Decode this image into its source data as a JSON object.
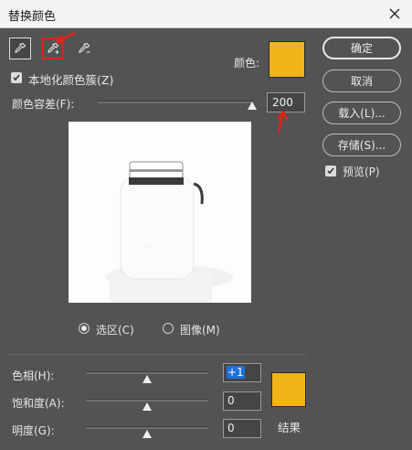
{
  "window": {
    "title": "替换颜色"
  },
  "tools": [
    {
      "name": "eyedropper-icon"
    },
    {
      "name": "eyedropper-plus-icon"
    },
    {
      "name": "eyedropper-minus-icon"
    }
  ],
  "selection": {
    "color_label": "颜色:",
    "localized_label": "本地化颜色簇(Z)",
    "localized_checked": true,
    "tolerance_label": "颜色容差(F):",
    "tolerance_value": "200",
    "tolerance_fraction": 1.0,
    "color_hex": "#f0b31a"
  },
  "view": {
    "selection_radio": "选区(C)",
    "image_radio": "图像(M)",
    "selected": "selection"
  },
  "replacement": {
    "hue_label": "色相(H):",
    "hue_value": "+1",
    "saturation_label": "饱和度(A):",
    "saturation_value": "0",
    "lightness_label": "明度(G):",
    "lightness_value": "0",
    "result_label": "结果",
    "result_color": "#f0b31a"
  },
  "buttons": {
    "ok": "确定",
    "cancel": "取消",
    "load": "载入(L)...",
    "save": "存储(S)..."
  },
  "preview_option": {
    "label": "预览(P)",
    "checked": true
  },
  "colors": {
    "accent": "#f0b31a",
    "annotation": "#e0241b",
    "dialog_bg": "#535353"
  }
}
